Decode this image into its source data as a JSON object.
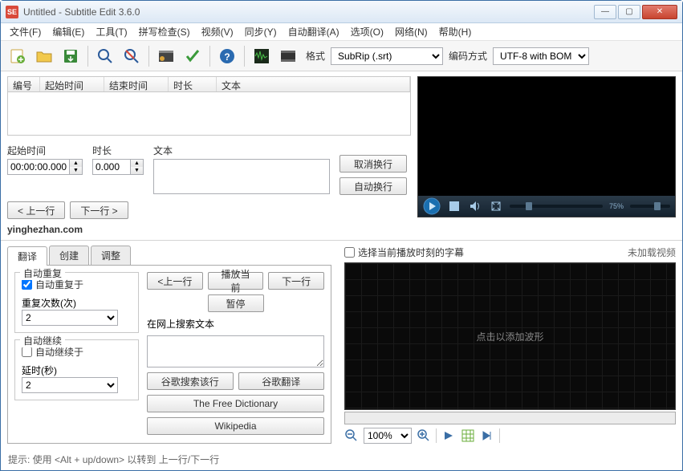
{
  "window": {
    "title": "Untitled - Subtitle Edit 3.6.0"
  },
  "menu": {
    "file": "文件(F)",
    "edit": "编辑(E)",
    "tools": "工具(T)",
    "spell": "拼写检查(S)",
    "video": "视频(V)",
    "sync": "同步(Y)",
    "autotrans": "自动翻译(A)",
    "options": "选项(O)",
    "network": "网络(N)",
    "help": "帮助(H)"
  },
  "toolbar": {
    "format_label": "格式",
    "format_value": "SubRip (.srt)",
    "encoding_label": "编码方式",
    "encoding_value": "UTF-8 with BOM"
  },
  "grid": {
    "col_num": "编号",
    "col_start": "起始时间",
    "col_end": "结束时间",
    "col_dur": "时长",
    "col_text": "文本"
  },
  "edit": {
    "start_label": "起始时间",
    "start_value": "00:00:00.000",
    "dur_label": "时长",
    "dur_value": "0.000",
    "text_label": "文本",
    "prev": "< 上一行",
    "next": "下一行 >",
    "cancel_wrap": "取消换行",
    "auto_wrap": "自动换行"
  },
  "watermark": "yinghezhan.com",
  "video": {
    "pct": "75%"
  },
  "tabs": {
    "translate": "翻译",
    "create": "创建",
    "adjust": "调整"
  },
  "translate": {
    "auto_repeat_group": "自动重复",
    "auto_repeat_chk": "自动重复于",
    "repeat_count_label": "重复次数(次)",
    "repeat_count_value": "2",
    "auto_continue_group": "自动继续",
    "auto_continue_chk": "自动继续于",
    "delay_label": "延时(秒)",
    "delay_value": "2",
    "prev": "<上一行",
    "play_current": "播放当前",
    "next": "下一行",
    "pause": "暂停",
    "search_label": "在网上搜索文本",
    "google_search": "谷歌搜索该行",
    "google_translate": "谷歌翻译",
    "free_dict": "The Free Dictionary",
    "wikipedia": "Wikipedia"
  },
  "waveform": {
    "select_chk": "选择当前播放时刻的字幕",
    "not_loaded": "未加载视频",
    "placeholder": "点击以添加波形"
  },
  "zoom": {
    "value": "100%"
  },
  "hint": "提示: 使用 <Alt + up/down> 以转到 上一行/下一行"
}
